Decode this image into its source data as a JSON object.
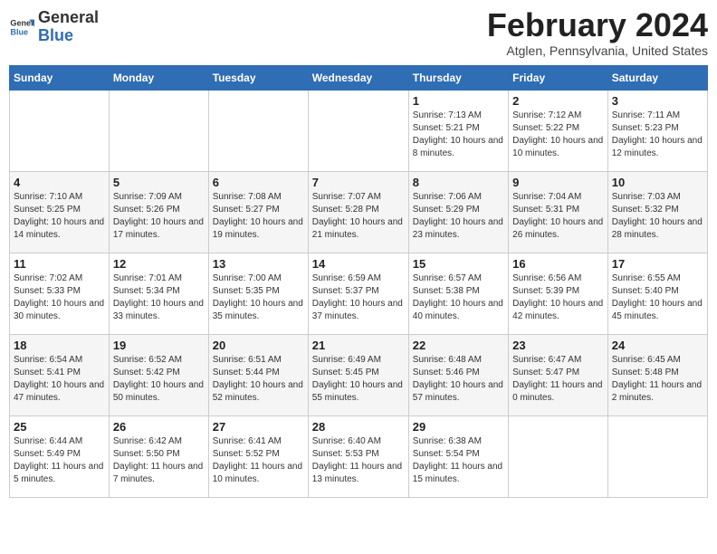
{
  "logo": {
    "line1": "General",
    "line2": "Blue"
  },
  "title": "February 2024",
  "subtitle": "Atglen, Pennsylvania, United States",
  "days_of_week": [
    "Sunday",
    "Monday",
    "Tuesday",
    "Wednesday",
    "Thursday",
    "Friday",
    "Saturday"
  ],
  "weeks": [
    [
      {
        "day": "",
        "sunrise": "",
        "sunset": "",
        "daylight": ""
      },
      {
        "day": "",
        "sunrise": "",
        "sunset": "",
        "daylight": ""
      },
      {
        "day": "",
        "sunrise": "",
        "sunset": "",
        "daylight": ""
      },
      {
        "day": "",
        "sunrise": "",
        "sunset": "",
        "daylight": ""
      },
      {
        "day": "1",
        "sunrise": "Sunrise: 7:13 AM",
        "sunset": "Sunset: 5:21 PM",
        "daylight": "Daylight: 10 hours and 8 minutes."
      },
      {
        "day": "2",
        "sunrise": "Sunrise: 7:12 AM",
        "sunset": "Sunset: 5:22 PM",
        "daylight": "Daylight: 10 hours and 10 minutes."
      },
      {
        "day": "3",
        "sunrise": "Sunrise: 7:11 AM",
        "sunset": "Sunset: 5:23 PM",
        "daylight": "Daylight: 10 hours and 12 minutes."
      }
    ],
    [
      {
        "day": "4",
        "sunrise": "Sunrise: 7:10 AM",
        "sunset": "Sunset: 5:25 PM",
        "daylight": "Daylight: 10 hours and 14 minutes."
      },
      {
        "day": "5",
        "sunrise": "Sunrise: 7:09 AM",
        "sunset": "Sunset: 5:26 PM",
        "daylight": "Daylight: 10 hours and 17 minutes."
      },
      {
        "day": "6",
        "sunrise": "Sunrise: 7:08 AM",
        "sunset": "Sunset: 5:27 PM",
        "daylight": "Daylight: 10 hours and 19 minutes."
      },
      {
        "day": "7",
        "sunrise": "Sunrise: 7:07 AM",
        "sunset": "Sunset: 5:28 PM",
        "daylight": "Daylight: 10 hours and 21 minutes."
      },
      {
        "day": "8",
        "sunrise": "Sunrise: 7:06 AM",
        "sunset": "Sunset: 5:29 PM",
        "daylight": "Daylight: 10 hours and 23 minutes."
      },
      {
        "day": "9",
        "sunrise": "Sunrise: 7:04 AM",
        "sunset": "Sunset: 5:31 PM",
        "daylight": "Daylight: 10 hours and 26 minutes."
      },
      {
        "day": "10",
        "sunrise": "Sunrise: 7:03 AM",
        "sunset": "Sunset: 5:32 PM",
        "daylight": "Daylight: 10 hours and 28 minutes."
      }
    ],
    [
      {
        "day": "11",
        "sunrise": "Sunrise: 7:02 AM",
        "sunset": "Sunset: 5:33 PM",
        "daylight": "Daylight: 10 hours and 30 minutes."
      },
      {
        "day": "12",
        "sunrise": "Sunrise: 7:01 AM",
        "sunset": "Sunset: 5:34 PM",
        "daylight": "Daylight: 10 hours and 33 minutes."
      },
      {
        "day": "13",
        "sunrise": "Sunrise: 7:00 AM",
        "sunset": "Sunset: 5:35 PM",
        "daylight": "Daylight: 10 hours and 35 minutes."
      },
      {
        "day": "14",
        "sunrise": "Sunrise: 6:59 AM",
        "sunset": "Sunset: 5:37 PM",
        "daylight": "Daylight: 10 hours and 37 minutes."
      },
      {
        "day": "15",
        "sunrise": "Sunrise: 6:57 AM",
        "sunset": "Sunset: 5:38 PM",
        "daylight": "Daylight: 10 hours and 40 minutes."
      },
      {
        "day": "16",
        "sunrise": "Sunrise: 6:56 AM",
        "sunset": "Sunset: 5:39 PM",
        "daylight": "Daylight: 10 hours and 42 minutes."
      },
      {
        "day": "17",
        "sunrise": "Sunrise: 6:55 AM",
        "sunset": "Sunset: 5:40 PM",
        "daylight": "Daylight: 10 hours and 45 minutes."
      }
    ],
    [
      {
        "day": "18",
        "sunrise": "Sunrise: 6:54 AM",
        "sunset": "Sunset: 5:41 PM",
        "daylight": "Daylight: 10 hours and 47 minutes."
      },
      {
        "day": "19",
        "sunrise": "Sunrise: 6:52 AM",
        "sunset": "Sunset: 5:42 PM",
        "daylight": "Daylight: 10 hours and 50 minutes."
      },
      {
        "day": "20",
        "sunrise": "Sunrise: 6:51 AM",
        "sunset": "Sunset: 5:44 PM",
        "daylight": "Daylight: 10 hours and 52 minutes."
      },
      {
        "day": "21",
        "sunrise": "Sunrise: 6:49 AM",
        "sunset": "Sunset: 5:45 PM",
        "daylight": "Daylight: 10 hours and 55 minutes."
      },
      {
        "day": "22",
        "sunrise": "Sunrise: 6:48 AM",
        "sunset": "Sunset: 5:46 PM",
        "daylight": "Daylight: 10 hours and 57 minutes."
      },
      {
        "day": "23",
        "sunrise": "Sunrise: 6:47 AM",
        "sunset": "Sunset: 5:47 PM",
        "daylight": "Daylight: 11 hours and 0 minutes."
      },
      {
        "day": "24",
        "sunrise": "Sunrise: 6:45 AM",
        "sunset": "Sunset: 5:48 PM",
        "daylight": "Daylight: 11 hours and 2 minutes."
      }
    ],
    [
      {
        "day": "25",
        "sunrise": "Sunrise: 6:44 AM",
        "sunset": "Sunset: 5:49 PM",
        "daylight": "Daylight: 11 hours and 5 minutes."
      },
      {
        "day": "26",
        "sunrise": "Sunrise: 6:42 AM",
        "sunset": "Sunset: 5:50 PM",
        "daylight": "Daylight: 11 hours and 7 minutes."
      },
      {
        "day": "27",
        "sunrise": "Sunrise: 6:41 AM",
        "sunset": "Sunset: 5:52 PM",
        "daylight": "Daylight: 11 hours and 10 minutes."
      },
      {
        "day": "28",
        "sunrise": "Sunrise: 6:40 AM",
        "sunset": "Sunset: 5:53 PM",
        "daylight": "Daylight: 11 hours and 13 minutes."
      },
      {
        "day": "29",
        "sunrise": "Sunrise: 6:38 AM",
        "sunset": "Sunset: 5:54 PM",
        "daylight": "Daylight: 11 hours and 15 minutes."
      },
      {
        "day": "",
        "sunrise": "",
        "sunset": "",
        "daylight": ""
      },
      {
        "day": "",
        "sunrise": "",
        "sunset": "",
        "daylight": ""
      }
    ]
  ]
}
